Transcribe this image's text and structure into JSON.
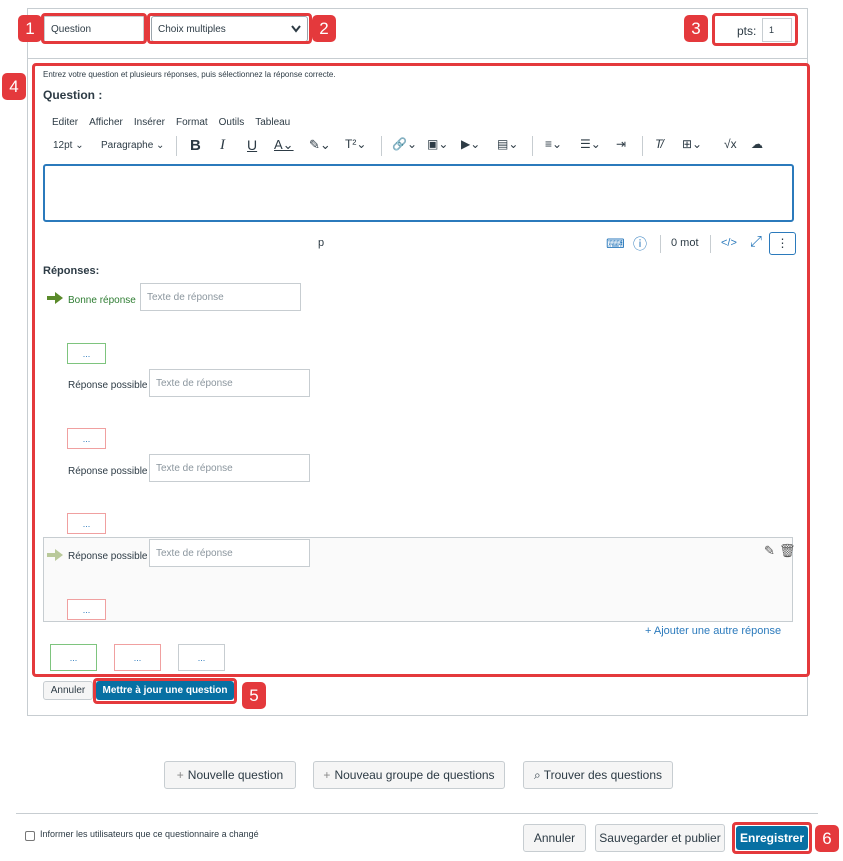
{
  "question_header": {
    "name_value": "Question",
    "type_select": "Choix multiples",
    "pts_label": "pts:",
    "pts_value": "1"
  },
  "editor": {
    "instructions": "Entrez votre question et plusieurs réponses, puis sélectionnez la réponse correcte.",
    "question_label": "Question :",
    "menu": [
      "Editer",
      "Afficher",
      "Insérer",
      "Format",
      "Outils",
      "Tableau"
    ],
    "font_size": "12pt",
    "paragraph": "Paragraphe",
    "path": "p",
    "word_count": "0 mot"
  },
  "answers": {
    "heading": "Réponses:",
    "correct_label": "Bonne réponse",
    "possible_label": "Réponse possible",
    "placeholder": "Texte de réponse",
    "comment_dots": "...",
    "add_another": "Ajouter une autre réponse"
  },
  "edit_actions": {
    "cancel": "Annuler",
    "update": "Mettre à jour une question"
  },
  "footer_actions": {
    "new_question": "Nouvelle question",
    "new_group": "Nouveau groupe de questions",
    "find_questions": "Trouver des questions"
  },
  "bottom_bar": {
    "notify_label": "Informer les utilisateurs que ce questionnaire a changé",
    "cancel": "Annuler",
    "save_publish": "Sauvegarder et publier",
    "save": "Enregistrer"
  },
  "callouts": [
    "1",
    "2",
    "3",
    "4",
    "5",
    "6"
  ],
  "colors": {
    "accent": "#0770a3",
    "callout": "#e4393c",
    "correct": "#2e7d32"
  }
}
